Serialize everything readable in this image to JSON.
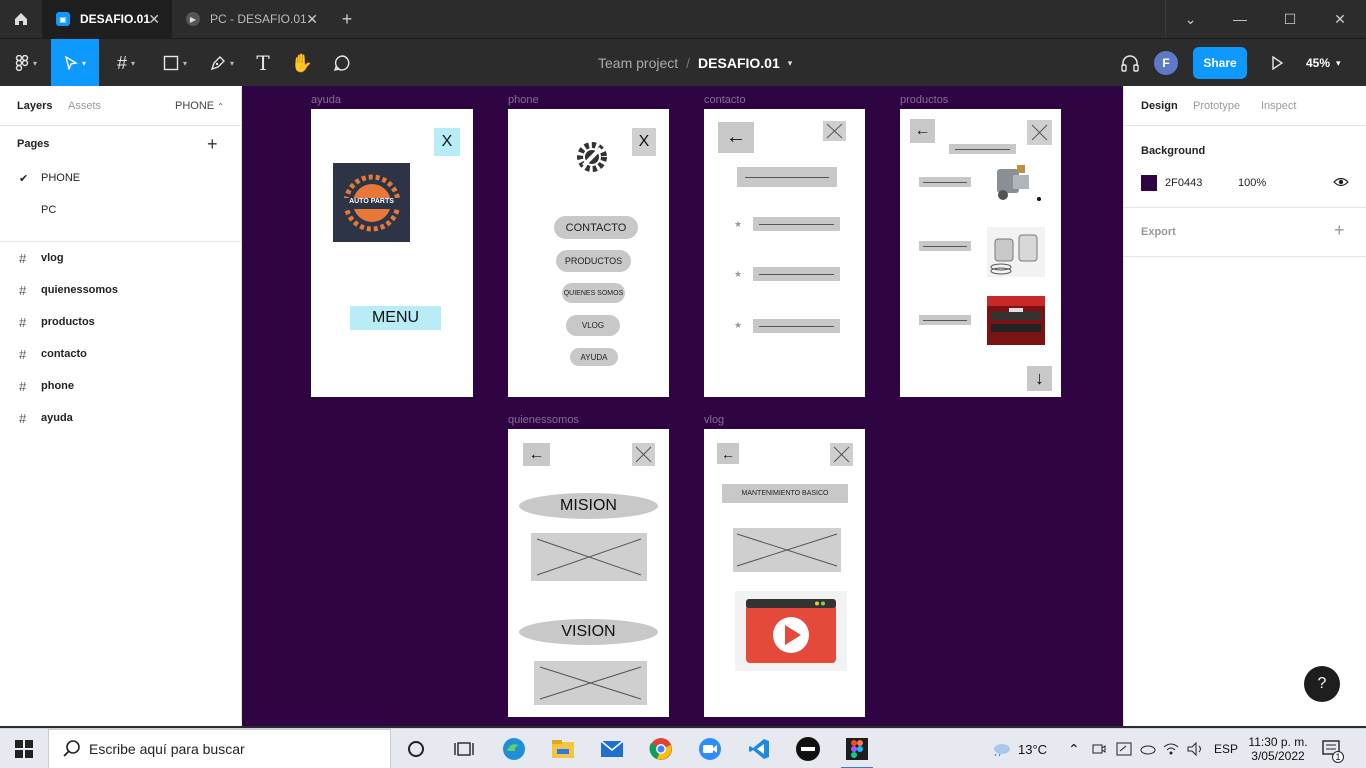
{
  "titlebar": {
    "tabs": [
      {
        "label": "DESAFIO.01",
        "active": true
      },
      {
        "label": "PC - DESAFIO.01",
        "active": false
      }
    ]
  },
  "toolbar": {
    "team": "Team project",
    "separator": "/",
    "file": "DESAFIO.01",
    "avatar_initial": "F",
    "share_label": "Share",
    "zoom": "45%"
  },
  "left_panel": {
    "tab_layers": "Layers",
    "tab_assets": "Assets",
    "current_page": "PHONE",
    "pages_title": "Pages",
    "pages": [
      {
        "label": "PHONE",
        "selected": true
      },
      {
        "label": "PC",
        "selected": false
      }
    ],
    "layers": [
      "vlog",
      "quienessomos",
      "productos",
      "contacto",
      "phone",
      "ayuda"
    ]
  },
  "canvas": {
    "background": "#2f0443",
    "frames": {
      "ayuda": {
        "label": "ayuda",
        "close": "X",
        "logo_text": "AUTO PARTS",
        "menu_label": "MENU"
      },
      "phone": {
        "label": "phone",
        "close": "X",
        "menu": [
          "CONTACTO",
          "PRODUCTOS",
          "QUIENES SOMOS",
          "VLOG",
          "AYUDA"
        ]
      },
      "contacto": {
        "label": "contacto"
      },
      "productos": {
        "label": "productos"
      },
      "quienessomos": {
        "label": "quienessomos",
        "mision": "MISION",
        "vision": "VISION"
      },
      "vlog": {
        "label": "vlog",
        "title": "MANTENIMIENTO BASICO"
      }
    }
  },
  "right_panel": {
    "tab_design": "Design",
    "tab_prototype": "Prototype",
    "tab_inspect": "Inspect",
    "background_title": "Background",
    "bg_hex": "2F0443",
    "bg_color": "#2f0443",
    "bg_opacity": "100%",
    "export_title": "Export",
    "help": "?"
  },
  "taskbar": {
    "search_placeholder": "Escribe aquí para buscar",
    "weather": "13°C",
    "lang": "ESP",
    "time": "11:30 p. m.",
    "date": "3/05/2022",
    "notif_count": "1"
  }
}
